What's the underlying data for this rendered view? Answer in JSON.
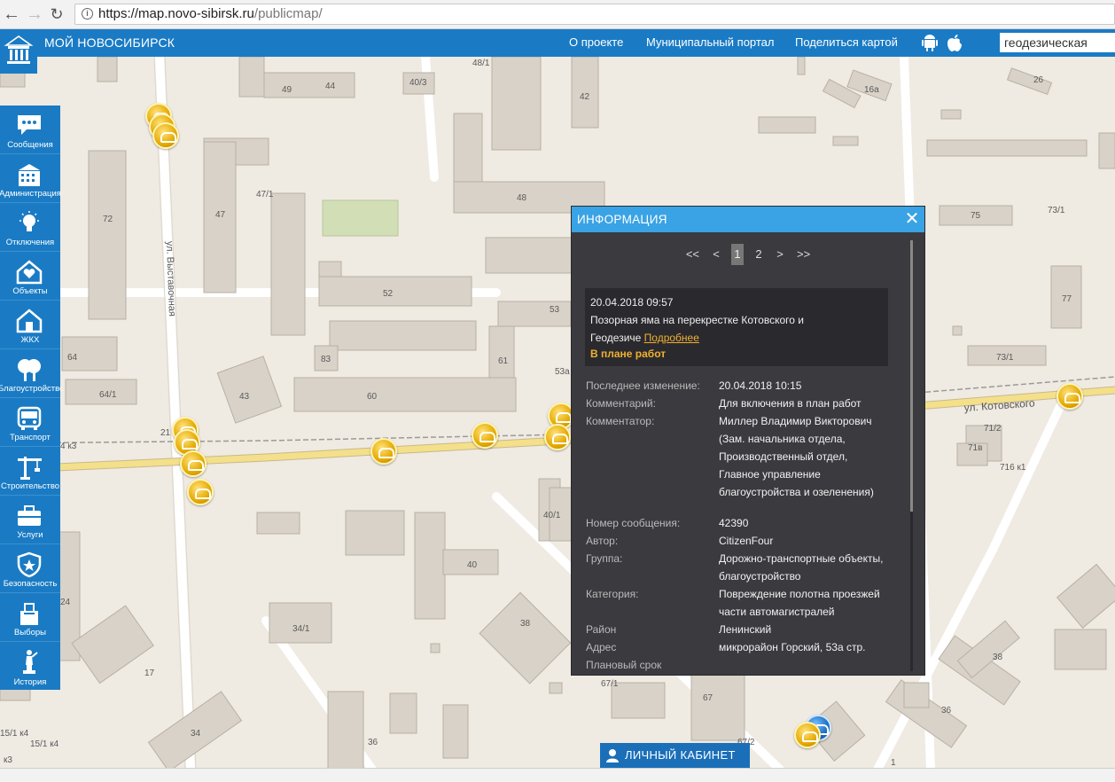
{
  "browser": {
    "url_host": "https://map.novo-sibirsk.ru",
    "url_path": "/publicmap/"
  },
  "header": {
    "title": "МОЙ НОВОСИБИРСК",
    "links": [
      "О проекте",
      "Муниципальный портал",
      "Поделиться картой"
    ],
    "search_value": "геодезическая"
  },
  "sidebar": {
    "items": [
      {
        "label": "Сообщения",
        "icon": "chat-icon"
      },
      {
        "label": "Администрация",
        "icon": "building-icon"
      },
      {
        "label": "Отключения",
        "icon": "lightbulb-icon"
      },
      {
        "label": "Объекты",
        "icon": "house-heart-icon"
      },
      {
        "label": "ЖКХ",
        "icon": "home-icon"
      },
      {
        "label": "Благоустройство",
        "icon": "tree-icon"
      },
      {
        "label": "Транспорт",
        "icon": "bus-icon"
      },
      {
        "label": "Строительство",
        "icon": "crane-icon"
      },
      {
        "label": "Услуги",
        "icon": "briefcase-icon"
      },
      {
        "label": "Безопасность",
        "icon": "shield-icon"
      },
      {
        "label": "Выборы",
        "icon": "ballot-icon"
      },
      {
        "label": "История",
        "icon": "monument-icon"
      }
    ]
  },
  "map": {
    "street_labels": [
      "ул. Выставочная",
      "ул. Котовского"
    ],
    "house_numbers": [
      "48/1",
      "49",
      "44",
      "40/3",
      "42",
      "16а",
      "26",
      "72",
      "47",
      "47/1",
      "48",
      "75",
      "73/1",
      "52",
      "53",
      "77",
      "64",
      "83",
      "61",
      "53а",
      "73/1",
      "64/1",
      "43",
      "60",
      "71/2",
      "71в",
      "716 к1",
      "21",
      "4 к3",
      "40/1",
      "40",
      "24",
      "34/1",
      "38",
      "38",
      "17",
      "67/1",
      "67",
      "36",
      "34",
      "36",
      "67/2",
      "1",
      "15/1 к4",
      "15/1 к4",
      "к3"
    ]
  },
  "popup": {
    "title": "ИНФОРМАЦИЯ",
    "pager": [
      "<<",
      "<",
      "1",
      "2",
      ">",
      ">>"
    ],
    "current_page": "1",
    "message": {
      "datetime": "20.04.2018 09:57",
      "text_line1": "Позорная яма на перекрестке Котовского и",
      "text_line2": "Геодезиче",
      "more_link": "Подробнее",
      "status": "В плане работ"
    },
    "fields": {
      "last_change_label": "Последнее изменение:",
      "last_change_value": "20.04.2018 10:15",
      "comment_label": "Комментарий:",
      "comment_value": "Для включения в план работ",
      "commentator_label": "Комментатор:",
      "commentator_lines": [
        "Миллер Владимир Викторович",
        "(Зам. начальника отдела,",
        "Производственный отдел,",
        "Главное управление",
        "благоустройства и озеленения)"
      ],
      "number_label": "Номер сообщения:",
      "number_value": "42390",
      "author_label": "Автор:",
      "author_value": "CitizenFour",
      "group_label": "Группа:",
      "group_lines": [
        "Дорожно-транспортные объекты,",
        "благоустройство"
      ],
      "category_label": "Категория:",
      "category_lines": [
        "Повреждение полотна проезжей",
        "части автомагистралей"
      ],
      "district_label": "Район",
      "district_value": "Ленинский",
      "address_label": "Адрес",
      "address_value": "микрорайон Горский, 53а стр.",
      "deadline_label": "Плановый срок"
    }
  },
  "cabinet": {
    "label": "ЛИЧНЫЙ КАБИНЕТ"
  },
  "colors": {
    "brand_blue": "#1a7bc4",
    "popup_header": "#39a3e5",
    "popup_bg": "#3a3a3f",
    "accent_orange": "#f0b030",
    "marker_gold": "#e5a900",
    "road_yellow": "#f4e08a"
  }
}
